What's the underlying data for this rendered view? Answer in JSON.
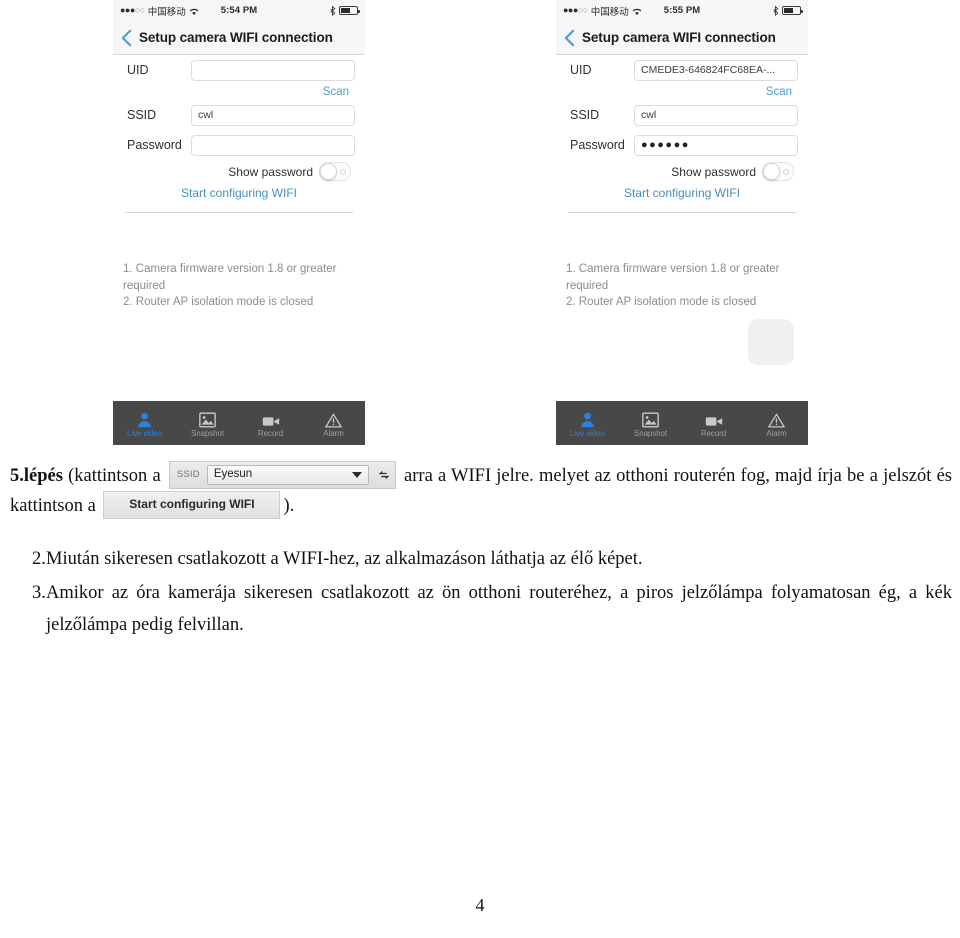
{
  "page": {
    "number": "4"
  },
  "phones": [
    {
      "id": "left",
      "statusbar": {
        "signal_filled": "●●●",
        "signal_hollow": "○○",
        "carrier": "中国移动",
        "time": "5:54 PM",
        "wifi_icon": "wifi-icon",
        "bluetooth_icon": "bluetooth-icon",
        "battery_icon": "battery-icon"
      },
      "nav": {
        "back_icon": "chevron-left-icon",
        "title": "Setup camera WIFI connection"
      },
      "form": {
        "uid_label": "UID",
        "uid_value": "",
        "uid_placeholder": "",
        "scan_label": "Scan",
        "ssid_label": "SSID",
        "ssid_value": "cwl",
        "password_label": "Password",
        "password_value": "",
        "show_password_label": "Show password",
        "start_label": "Start configuring WIFI"
      },
      "notes": "1. Camera firmware version 1.8 or greater required\n2. Router AP isolation mode is closed",
      "hud_visible": false,
      "tabs": [
        {
          "label": "Live video",
          "icon": "person-icon",
          "active": true
        },
        {
          "label": "Snapshot",
          "icon": "photo-icon",
          "active": false
        },
        {
          "label": "Record",
          "icon": "video-camera-icon",
          "active": false
        },
        {
          "label": "Alarm",
          "icon": "warning-triangle-icon",
          "active": false
        }
      ]
    },
    {
      "id": "right",
      "statusbar": {
        "signal_filled": "●●●",
        "signal_hollow": "○○",
        "carrier": "中国移动",
        "time": "5:55 PM",
        "wifi_icon": "wifi-icon",
        "bluetooth_icon": "bluetooth-icon",
        "battery_icon": "battery-icon"
      },
      "nav": {
        "back_icon": "chevron-left-icon",
        "title": "Setup camera WIFI connection"
      },
      "form": {
        "uid_label": "UID",
        "uid_value": "CMEDE3-646824FC68EA-...",
        "uid_placeholder": "",
        "scan_label": "Scan",
        "ssid_label": "SSID",
        "ssid_value": "cwl",
        "password_label": "Password",
        "password_value": "●●●●●●",
        "show_password_label": "Show password",
        "start_label": "Start configuring WIFI"
      },
      "notes": "1. Camera firmware version 1.8 or greater required\n2. Router AP isolation mode is closed",
      "hud_visible": true,
      "tabs": [
        {
          "label": "Live video",
          "icon": "person-icon",
          "active": true
        },
        {
          "label": "Snapshot",
          "icon": "photo-icon",
          "active": false
        },
        {
          "label": "Record",
          "icon": "video-camera-icon",
          "active": false
        },
        {
          "label": "Alarm",
          "icon": "warning-triangle-icon",
          "active": false
        }
      ]
    }
  ],
  "document": {
    "step5": {
      "lead": "5.lépés",
      "text_a": " (kattintson a ",
      "text_b": " arra a WIFI jelre. melyet az otthoni routerén fog, majd írja be a jelszót és kattintson a ",
      "text_c": ")."
    },
    "inline_widgets": {
      "ssid_label": "SSID",
      "ssid_value": "Eyesun",
      "dropdown_icon": "chevron-down-icon",
      "refresh_icon": "refresh-icon",
      "start_button_label": "Start configuring WIFI"
    },
    "list": [
      {
        "num": "2.",
        "text": "Miután sikeresen csatlakozott a WIFI-hez, az alkalmazáson láthatja az élő képet."
      },
      {
        "num": "3.",
        "text": "Amikor az óra kamerája sikeresen csatlakozott az ön otthoni routeréhez, a piros jelzőlámpa folyamatosan ég, a kék jelzőlámpa pedig felvillan."
      }
    ]
  },
  "colors": {
    "link": "#4a9fd4",
    "tab_active": "#2f7fe0",
    "tabbar_bg": "#484848",
    "statusbar_bg": "#f6f6f6"
  }
}
